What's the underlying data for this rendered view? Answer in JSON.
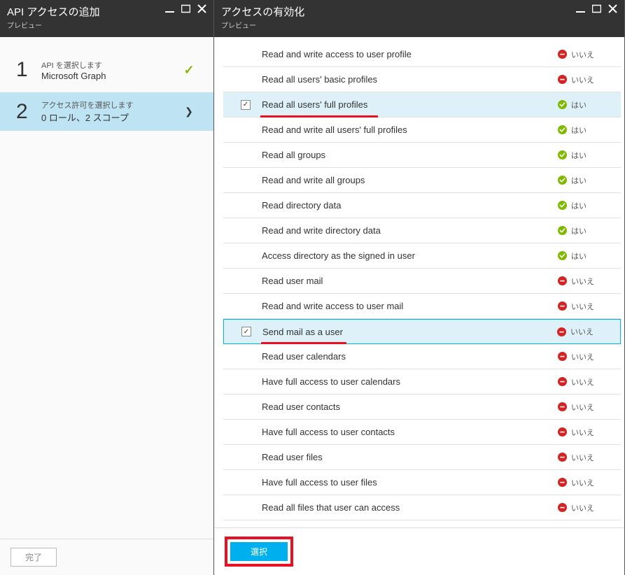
{
  "leftPanel": {
    "title": "API アクセスの追加",
    "subtitle": "プレビュー",
    "steps": [
      {
        "num": "1",
        "label": "API を選択します",
        "value": "Microsoft Graph",
        "done": true,
        "active": false
      },
      {
        "num": "2",
        "label": "アクセス許可を選択します",
        "value": "0 ロール、2 スコープ",
        "done": false,
        "active": true
      }
    ],
    "footerButton": "完了"
  },
  "rightPanel": {
    "title": "アクセスの有効化",
    "subtitle": "プレビュー",
    "statusLabels": {
      "yes": "はい",
      "no": "いいえ"
    },
    "footerButton": "選択",
    "permissions": [
      {
        "name": "Read and write access to user profile",
        "admin": false,
        "checked": false,
        "showCheck": false
      },
      {
        "name": "Read all users' basic profiles",
        "admin": false,
        "checked": false,
        "showCheck": false
      },
      {
        "name": "Read all users' full profiles",
        "admin": true,
        "checked": true,
        "showCheck": true,
        "underline": 168
      },
      {
        "name": "Read and write all users' full profiles",
        "admin": true,
        "checked": false,
        "showCheck": false
      },
      {
        "name": "Read all groups",
        "admin": true,
        "checked": false,
        "showCheck": false
      },
      {
        "name": "Read and write all groups",
        "admin": true,
        "checked": false,
        "showCheck": false
      },
      {
        "name": "Read directory data",
        "admin": true,
        "checked": false,
        "showCheck": false
      },
      {
        "name": "Read and write directory data",
        "admin": true,
        "checked": false,
        "showCheck": false
      },
      {
        "name": "Access directory as the signed in user",
        "admin": true,
        "checked": false,
        "showCheck": false
      },
      {
        "name": "Read user mail",
        "admin": false,
        "checked": false,
        "showCheck": false
      },
      {
        "name": "Read and write access to user mail",
        "admin": false,
        "checked": false,
        "showCheck": false
      },
      {
        "name": "Send mail as a user",
        "admin": false,
        "checked": true,
        "showCheck": true,
        "focused": true,
        "underline": 122
      },
      {
        "name": "Read user calendars",
        "admin": false,
        "checked": false,
        "showCheck": false
      },
      {
        "name": "Have full access to user calendars",
        "admin": false,
        "checked": false,
        "showCheck": false
      },
      {
        "name": "Read user contacts",
        "admin": false,
        "checked": false,
        "showCheck": false
      },
      {
        "name": "Have full access to user contacts",
        "admin": false,
        "checked": false,
        "showCheck": false
      },
      {
        "name": "Read user files",
        "admin": false,
        "checked": false,
        "showCheck": false
      },
      {
        "name": "Have full access to user files",
        "admin": false,
        "checked": false,
        "showCheck": false
      },
      {
        "name": "Read all files that user can access",
        "admin": false,
        "checked": false,
        "showCheck": false
      }
    ]
  }
}
